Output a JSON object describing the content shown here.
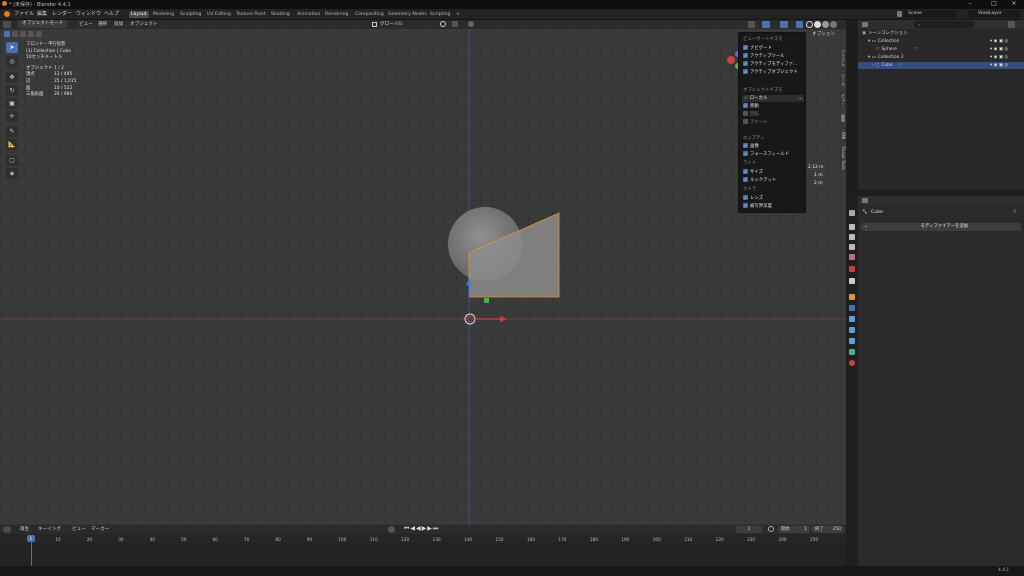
{
  "window": {
    "title": "* (未保存) - Blender 4.4.1"
  },
  "menubar": {
    "items": [
      "ファイル",
      "編集",
      "レンダー",
      "ウィンドウ",
      "ヘルプ"
    ],
    "workspaces": [
      "Layout",
      "Modeling",
      "Sculpting",
      "UV Editing",
      "Texture Paint",
      "Shading",
      "Animation",
      "Rendering",
      "Compositing",
      "Geometry Nodes",
      "Scripting"
    ],
    "add_tab": "+",
    "scene": "Scene",
    "view_layer": "ViewLayer"
  },
  "viewport_header": {
    "mode": "オブジェクトモード",
    "menus": [
      "ビュー",
      "選択",
      "追加",
      "オブジェクト"
    ],
    "transform": "グローバル",
    "options": "オプション"
  },
  "overlay_info": {
    "view_name": "フロント・平行投影",
    "collection_line": "(1) Collection | Cube",
    "scale": "10センチメートル",
    "stats": [
      {
        "label": "オブジェクト",
        "value": "1 / 2"
      },
      {
        "label": "頂点",
        "value": "13 / 495"
      },
      {
        "label": "辺",
        "value": "25 / 1,015"
      },
      {
        "label": "面",
        "value": "10 / 522"
      },
      {
        "label": "三角形面",
        "value": "20 / 980"
      }
    ]
  },
  "gizmo_dropdown": {
    "viewport_gizmos_heading": "ビューポートギズモ",
    "viewport_items": [
      {
        "label": "ナビゲート",
        "checked": true
      },
      {
        "label": "アクティブツール",
        "checked": true
      },
      {
        "label": "アクティブモディファ...",
        "checked": true
      },
      {
        "label": "アクティブオブジェクト",
        "checked": true
      }
    ],
    "object_gizmos_heading": "オブジェクトギズモ",
    "orientation": "ローカル",
    "object_items": [
      {
        "label": "移動",
        "checked": true
      },
      {
        "label": "回転",
        "checked": false
      },
      {
        "label": "スケール",
        "checked": false
      }
    ],
    "empty_heading": "エンプティ",
    "empty_items": [
      {
        "label": "画像",
        "checked": true
      },
      {
        "label": "フォースフィールド",
        "checked": true
      }
    ],
    "light_heading": "ライト",
    "light_items": [
      {
        "label": "サイズ",
        "checked": true
      },
      {
        "label": "ルックアット",
        "checked": true
      }
    ],
    "camera_heading": "カメラ",
    "camera_items": [
      {
        "label": "レンズ",
        "checked": true
      },
      {
        "label": "被写界深度",
        "checked": true
      }
    ]
  },
  "n_panel_values": [
    "2.12 m",
    "1 m",
    "2 m"
  ],
  "sidebar_tabs": [
    "アイテム",
    "ツール",
    "ビュー",
    "編集",
    "AMI",
    "Tissue Tools"
  ],
  "outliner": {
    "title": "シーンコレクション",
    "rows": [
      {
        "label": "Collection",
        "depth": 1,
        "selected": false
      },
      {
        "label": "Sphere",
        "depth": 2,
        "selected": false
      },
      {
        "label": "Collection 2",
        "depth": 1,
        "selected": false
      },
      {
        "label": "Cube",
        "depth": 2,
        "selected": true
      }
    ]
  },
  "properties": {
    "object_name": "Cube",
    "add_modifier": "モディファイアーを追加"
  },
  "timeline": {
    "menus": [
      "再生",
      "キーイング",
      "ビュー",
      "マーカー"
    ],
    "current_frame": "1",
    "start_label": "開始",
    "start": "1",
    "end_label": "終了",
    "end": "250",
    "ticks": [
      "1",
      "10",
      "20",
      "30",
      "40",
      "50",
      "60",
      "70",
      "80",
      "90",
      "100",
      "110",
      "120",
      "130",
      "140",
      "150",
      "160",
      "170",
      "180",
      "190",
      "200",
      "210",
      "220",
      "230",
      "240",
      "250"
    ]
  },
  "statusbar": {
    "right": "4.4.1"
  },
  "colors": {
    "accent": "#4772b3",
    "selection_orange": "#e5952b",
    "x_axis": "#c94040",
    "z_axis": "#3f7be0"
  }
}
